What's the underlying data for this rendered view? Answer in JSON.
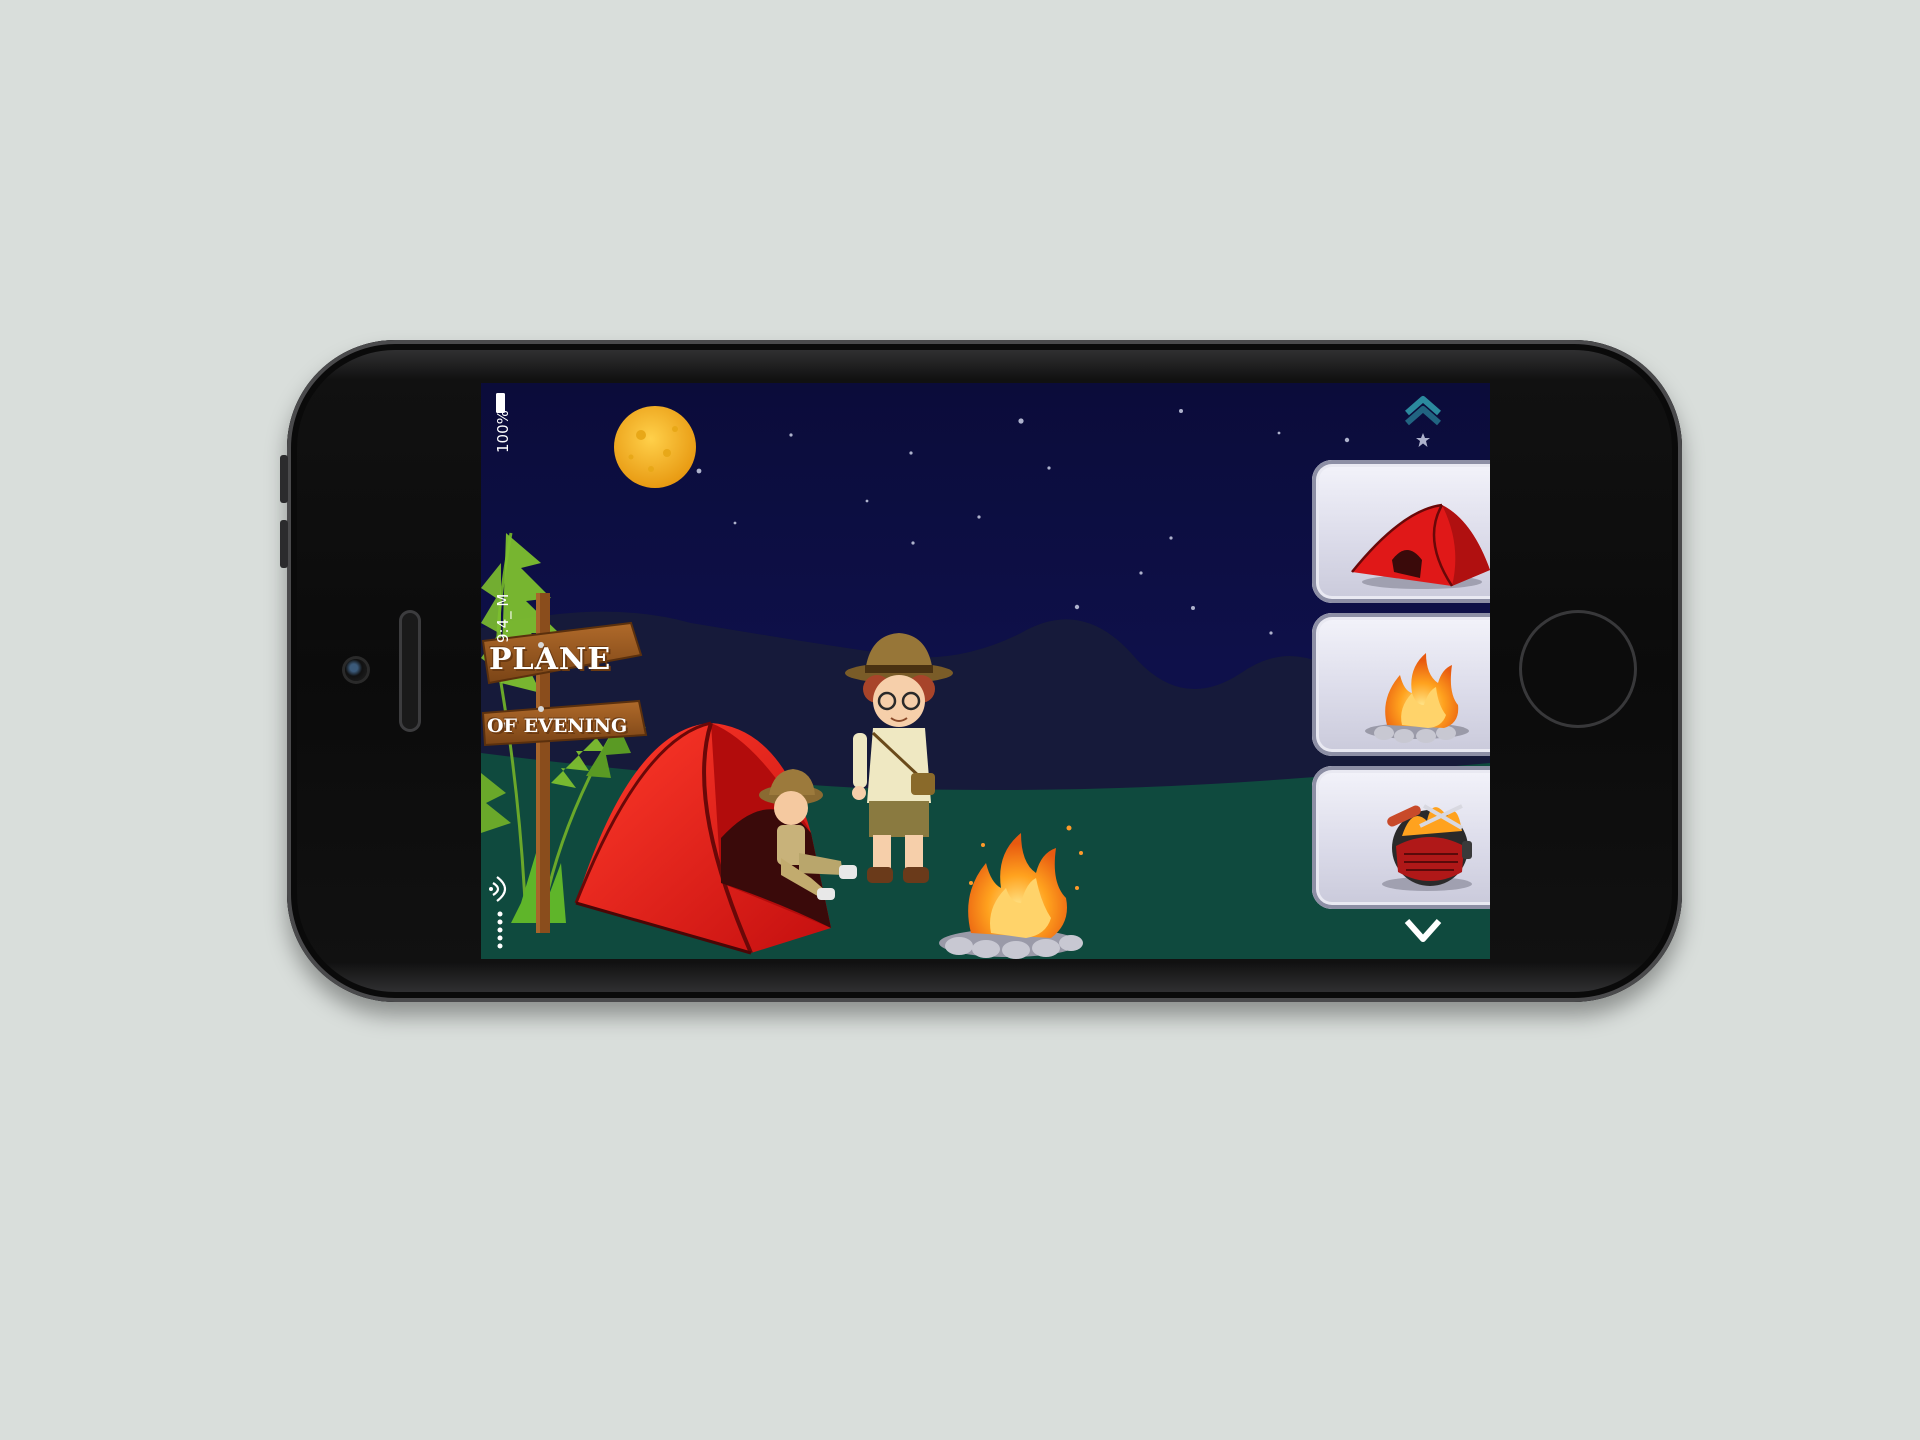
{
  "status_bar": {
    "battery": "100%",
    "time": "9:4_ M"
  },
  "sign": {
    "line1": "PLANE",
    "line2": "OF EVENING"
  },
  "item_panel": {
    "items": [
      {
        "name": "tent-item",
        "icon": "tent-icon"
      },
      {
        "name": "campfire-item",
        "icon": "campfire-icon"
      },
      {
        "name": "bbq-grill-item",
        "icon": "bbq-grill-icon"
      }
    ],
    "scroll_up_icon": "chevron-up-icon",
    "scroll_down_icon": "chevron-down-icon"
  },
  "colors": {
    "sky": "#0f1250",
    "ground": "#0f4a3e",
    "tent_red": "#e01818",
    "moon": "#f2b31e",
    "accent_teal": "#2b8a9e"
  }
}
